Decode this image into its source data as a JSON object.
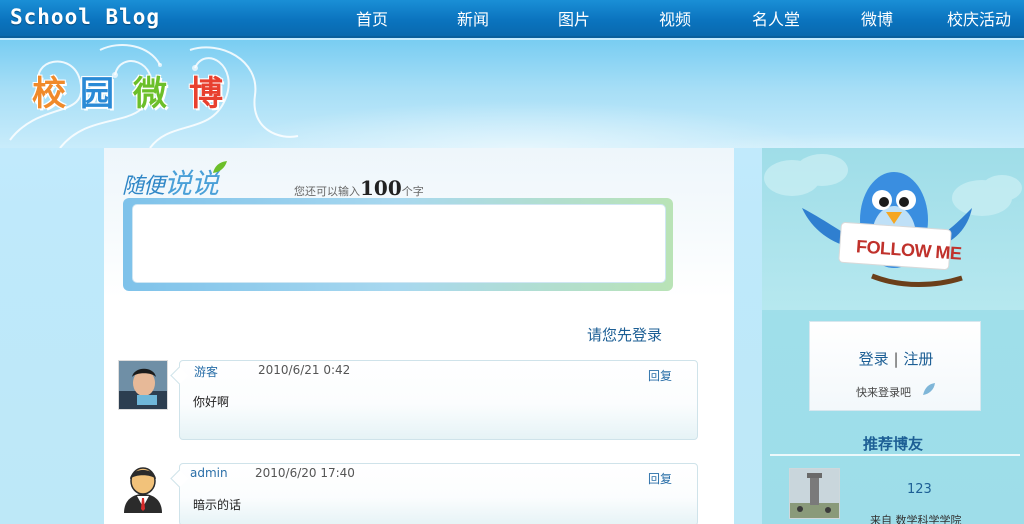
{
  "brand": "School Blog",
  "nav": [
    {
      "label": "首页"
    },
    {
      "label": "新闻"
    },
    {
      "label": "图片"
    },
    {
      "label": "视频"
    },
    {
      "label": "名人堂"
    },
    {
      "label": "微博"
    },
    {
      "label": "校庆活动"
    }
  ],
  "banner": {
    "logo_chars": [
      "校",
      "园",
      "微",
      "博"
    ],
    "logo_colors": [
      "#f08a2a",
      "#2a8ad6",
      "#6cbf2a",
      "#e8402f"
    ]
  },
  "compose": {
    "title_small": "随便",
    "title_big": "说说",
    "counter_prefix": "您还可以输入",
    "counter_num": "100",
    "counter_suffix": "个字",
    "login_prompt": "请您先登录"
  },
  "posts": [
    {
      "user": "游客",
      "time": "2010/6/21 0:42",
      "reply": "回复",
      "text": "你好啊"
    },
    {
      "user": "admin",
      "time": "2010/6/20 17:40",
      "reply": "回复",
      "text": "暗示的话"
    }
  ],
  "sidebar": {
    "follow_text": "FOLLOW ME",
    "login_label": "登录",
    "separator": "|",
    "register_label": "注册",
    "login_sub": "快来登录吧",
    "reco_title": "推荐博友",
    "friend": {
      "name": "123",
      "from": "来自 数学科学学院"
    }
  },
  "colors": {
    "nav_bar": "#0b74bf",
    "link": "#1d5f95",
    "right_panel": "#a6e1ec"
  }
}
